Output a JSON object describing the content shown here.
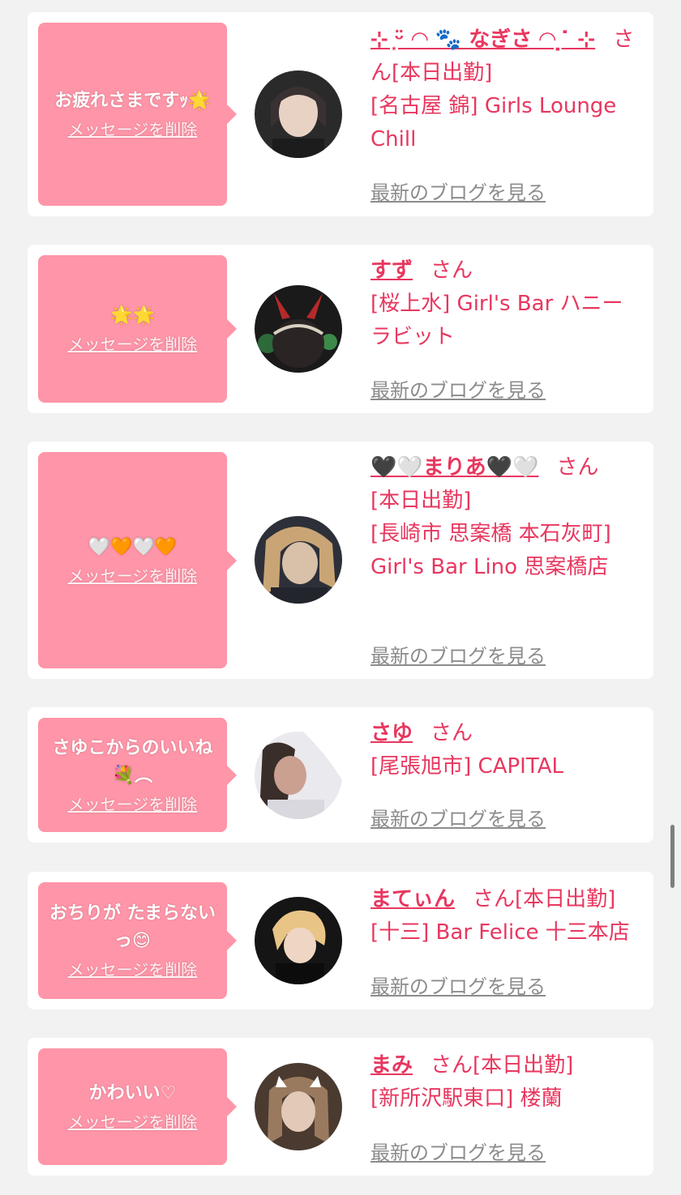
{
  "cards": [
    {
      "message": "お疲れさまですｯ🌟",
      "delete_label": "メッセージを削除",
      "name": "⊹ ͙ᵕ̈ ◠ 🐾 なぎさ ◠ ̣ ̇ ⊹",
      "san": "さん",
      "status": "[本日出勤]",
      "shop": "[名古屋 錦] Girls Lounge Chill",
      "blog_label": "最新のブログを見る",
      "avatar_colors": [
        "#2a2a2a",
        "#e8d2c4"
      ]
    },
    {
      "message": "🌟🌟",
      "delete_label": "メッセージを削除",
      "name": "すず",
      "san": "さん",
      "status": "",
      "shop": "[桜上水] Girl's Bar ハニーラビット",
      "blog_label": "最新のブログを見る",
      "avatar_colors": [
        "#3d1414",
        "#b42a2a"
      ]
    },
    {
      "message": "🤍🧡🤍🧡",
      "delete_label": "メッセージを削除",
      "name": "🖤🤍まりあ🖤🤍",
      "san": "さん",
      "status": "[本日出勤]",
      "shop": "[長崎市 思案橋 本石灰町] Girl's Bar Lino 思案橋店",
      "blog_label": "最新のブログを見る",
      "avatar_colors": [
        "#2d3038",
        "#d9c0a8"
      ]
    },
    {
      "message": "さゆこからのいいね💐︵",
      "delete_label": "メッセージを削除",
      "name": "さゆ",
      "san": "さん",
      "status": "",
      "shop": "[尾張旭市] CAPITAL",
      "blog_label": "最新のブログを見る",
      "avatar_colors": [
        "#e9e9ee",
        "#caa090"
      ]
    },
    {
      "message": "おちりが たまらないっ😊",
      "delete_label": "メッセージを削除",
      "name": "まてぃん",
      "san": "さん",
      "status": "[本日出勤]",
      "shop": "[十三] Bar Felice 十三本店",
      "blog_label": "最新のブログを見る",
      "avatar_colors": [
        "#151515",
        "#e8c487"
      ]
    },
    {
      "message": "かわいい♡",
      "delete_label": "メッセージを削除",
      "name": "まみ",
      "san": "さん",
      "status": "[本日出勤]",
      "shop": "[新所沢駅東口] 楼蘭",
      "blog_label": "最新のブログを見る",
      "avatar_colors": [
        "#4a3a30",
        "#e3c9b8"
      ]
    }
  ]
}
